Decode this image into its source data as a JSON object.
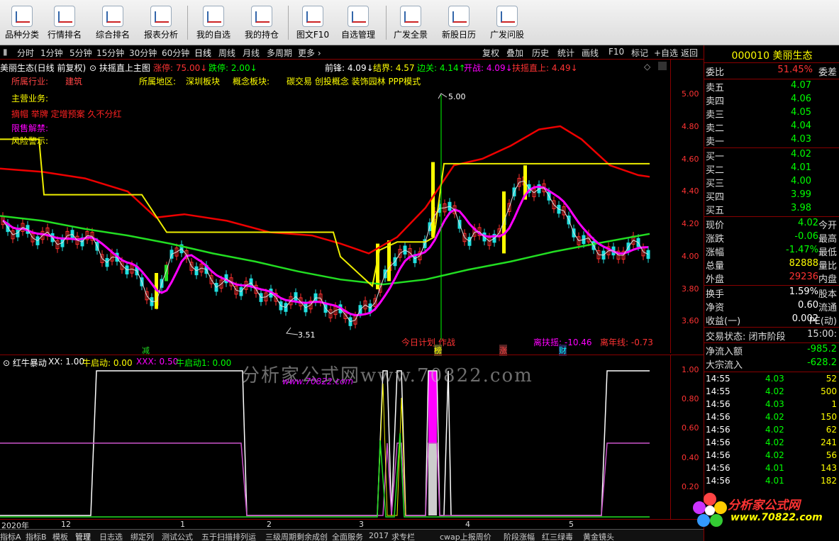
{
  "toolbar": {
    "buttons": [
      "品种分类",
      "行情排名",
      "综合排名",
      "报表分析",
      "我的自选",
      "我的持仓",
      "图文F10",
      "自选管理",
      "广发全景",
      "新股日历",
      "广发问股"
    ]
  },
  "periodbar": {
    "items": [
      "分时",
      "1分钟",
      "5分钟",
      "15分钟",
      "30分钟",
      "60分钟",
      "日线",
      "周线",
      "月线",
      "多周期",
      "更多 ›"
    ],
    "right_items": [
      "复权",
      "叠加",
      "历史",
      "统计",
      "画线",
      "F10",
      "标记",
      "+自选",
      "返回"
    ]
  },
  "main_header": {
    "title": "美丽生态(日线 前复权)",
    "indicator": "扶摇直上主图",
    "limit_up": "涨停: 75.00↓",
    "limit_down": "跌停: 2.00↓",
    "front": "前锋: 4.09↓",
    "boundary": "结界: 4.57",
    "side": "边关: 4.14↑",
    "open_war": "开战: 4.09↓",
    "soar": "扶摇直上: 4.49↓"
  },
  "overlay": {
    "industry_label": "所属行业:",
    "industry_value": "建筑",
    "region_label": "所属地区:",
    "region_value": "深圳板块",
    "concept_label": "概念板块:",
    "concept_value": "碳交易 创投概念 装饰园林 PPP模式",
    "main_biz_label": "主营业务:",
    "tags": "摘帽 举牌 定增预案 久不分红",
    "restricted_label": "限售解禁:",
    "risk_label": "风险警示:",
    "annot_high": "5.00",
    "annot_low": "3.51",
    "plan": "今日计划 作战",
    "dist_label": "离扶摇: -10.46",
    "year_label": "离年线: -0.73",
    "marker_jian": "减",
    "marker_bang": "榜",
    "marker_zhang": "涨",
    "marker_cai": "财"
  },
  "main_axis": [
    "5.00",
    "4.80",
    "4.60",
    "4.40",
    "4.20",
    "4.00",
    "3.80",
    "3.60"
  ],
  "sub_header": {
    "name": "红牛暴动",
    "xx": "XX: 1.00",
    "start": "牛启动: 0.00",
    "xxx": "XXX: 0.50",
    "start1": "牛启动1: 0.00"
  },
  "sub_axis": [
    "1.00",
    "0.80",
    "0.60",
    "0.40",
    "0.20"
  ],
  "date_axis": [
    "2020年",
    "12",
    "1",
    "2",
    "3",
    "4",
    "5"
  ],
  "bottom_tabs": [
    "指标A",
    "指标B",
    "模板",
    "管理",
    "日志选",
    "绑定列",
    "测试公式",
    "五于扫描排列运",
    "三级周期",
    "剩余成创",
    "全面服务",
    "2017",
    "求专栏",
    "cwap上报周价",
    "阶段涨幅",
    "红三绿毒",
    "黄金镜头"
  ],
  "watermark": {
    "text": "分析家公式网www.70822.com",
    "sub": "www.70822.com",
    "logo": "分析家公式网",
    "logo_url": "www.70822.com"
  },
  "right_panel": {
    "code": "000010",
    "name": "美丽生态",
    "ratio_label": "委比",
    "ratio_value": "51.45%",
    "ratio_right": "委差",
    "asks": [
      [
        "卖五",
        "4.07"
      ],
      [
        "卖四",
        "4.06"
      ],
      [
        "卖三",
        "4.05"
      ],
      [
        "卖二",
        "4.04"
      ],
      [
        "卖一",
        "4.03"
      ]
    ],
    "bids": [
      [
        "买一",
        "4.02"
      ],
      [
        "买二",
        "4.01"
      ],
      [
        "买三",
        "4.00"
      ],
      [
        "买四",
        "3.99"
      ],
      [
        "买五",
        "3.98"
      ]
    ],
    "stats": [
      [
        "现价",
        "4.02",
        "今开"
      ],
      [
        "涨跌",
        "-0.06",
        "最高"
      ],
      [
        "涨幅",
        "-1.47%",
        "最低"
      ],
      [
        "总量",
        "82888",
        "量比"
      ],
      [
        "外盘",
        "29236",
        "内盘"
      ]
    ],
    "stats2": [
      [
        "换手",
        "1.59%",
        "股本"
      ],
      [
        "净资",
        "0.60",
        "流通"
      ],
      [
        "收益(一)",
        "0.002",
        "PE(动)"
      ]
    ],
    "status_label": "交易状态: 闭市阶段",
    "status_time": "15:00:",
    "flow_in_label": "净流入额",
    "flow_in_value": "-985.2",
    "big_in_label": "大宗流入",
    "big_in_value": "-628.2",
    "ticks": [
      [
        "14:55",
        "4.03",
        "52"
      ],
      [
        "14:55",
        "4.02",
        "500"
      ],
      [
        "14:56",
        "4.03",
        "1"
      ],
      [
        "14:56",
        "4.02",
        "150"
      ],
      [
        "14:56",
        "4.02",
        "62"
      ],
      [
        "14:56",
        "4.02",
        "241"
      ],
      [
        "14:56",
        "4.02",
        "56"
      ],
      [
        "14:56",
        "4.01",
        "143"
      ],
      [
        "14:56",
        "4.01",
        "182"
      ]
    ]
  }
}
